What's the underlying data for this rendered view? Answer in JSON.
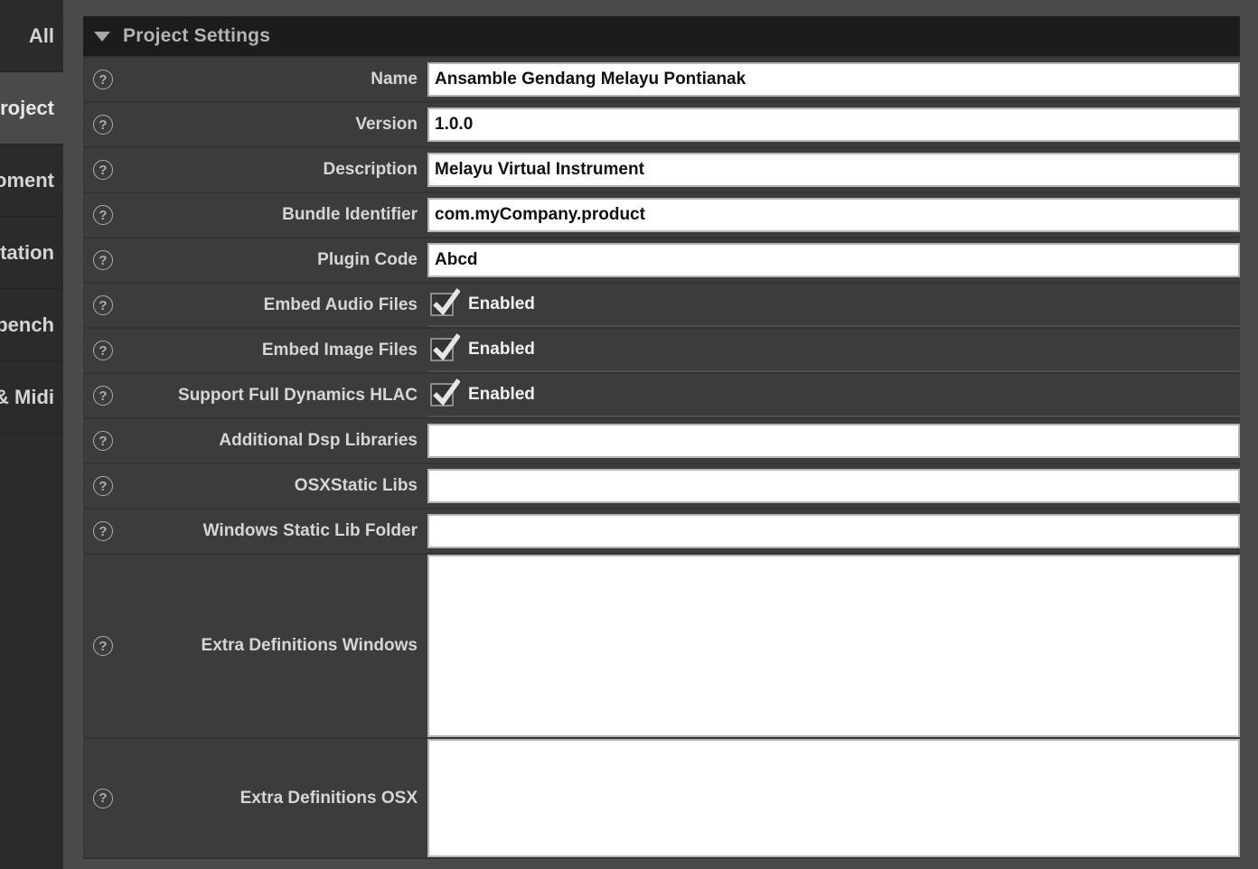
{
  "icons": {
    "help": "?"
  },
  "colors": {
    "background": "#4a4a4a",
    "sidebar": "#2b2b2b",
    "sidebar_selected": "#4a4a4a",
    "panel_row": "#3c3c3c",
    "panel_header": "#1c1c1c",
    "label_text": "#d6d6d6",
    "title_text": "#b4b4b4",
    "input_background": "#ffffff",
    "input_text": "#111111",
    "input_border": "#b5b5b5"
  },
  "sidebar": {
    "items": [
      {
        "label": "All",
        "selected": false
      },
      {
        "label": "roject",
        "selected": true
      },
      {
        "label": "oment",
        "selected": false
      },
      {
        "label": "tation",
        "selected": false
      },
      {
        "label": "bench",
        "selected": false
      },
      {
        "label": "& Midi",
        "selected": false
      }
    ]
  },
  "panel": {
    "title": "Project Settings",
    "collapsed": false,
    "fields": [
      {
        "label": "Name",
        "type": "text",
        "value": "Ansamble Gendang Melayu Pontianak"
      },
      {
        "label": "Version",
        "type": "text",
        "value": "1.0.0"
      },
      {
        "label": "Description",
        "type": "text",
        "value": "Melayu Virtual Instrument"
      },
      {
        "label": "Bundle Identifier",
        "type": "text",
        "value": "com.myCompany.product"
      },
      {
        "label": "Plugin Code",
        "type": "text",
        "value": "Abcd"
      },
      {
        "label": "Embed Audio Files",
        "type": "checkbox",
        "value": "Enabled",
        "checked": true
      },
      {
        "label": "Embed Image Files",
        "type": "checkbox",
        "value": "Enabled",
        "checked": true
      },
      {
        "label": "Support Full Dynamics HLAC",
        "type": "checkbox",
        "value": "Enabled",
        "checked": true
      },
      {
        "label": "Additional Dsp Libraries",
        "type": "text",
        "value": ""
      },
      {
        "label": "OSXStatic Libs",
        "type": "text",
        "value": ""
      },
      {
        "label": "Windows Static Lib Folder",
        "type": "text",
        "value": ""
      },
      {
        "label": "Extra Definitions Windows",
        "type": "textarea",
        "value": ""
      },
      {
        "label": "Extra Definitions OSX",
        "type": "textarea",
        "value": ""
      }
    ]
  }
}
